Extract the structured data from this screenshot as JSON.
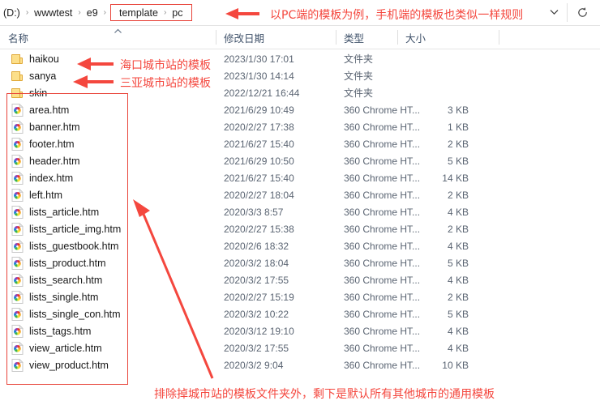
{
  "address_bar": {
    "crumbs": [
      {
        "label": "(D:)",
        "highlight": false
      },
      {
        "label": "wwwtest",
        "highlight": false
      },
      {
        "label": "e9",
        "highlight": false
      }
    ],
    "highlighted_crumbs": [
      {
        "label": "template"
      },
      {
        "label": "pc"
      }
    ],
    "separator": "›",
    "dropdown_icon": "chevron-down-icon",
    "refresh_icon": "refresh-icon",
    "refresh_glyph": "↻",
    "chevron_glyph": "⌄"
  },
  "columns": {
    "name": "名称",
    "date": "修改日期",
    "type": "类型",
    "size": "大小",
    "sort_caret": "⌃"
  },
  "rows": [
    {
      "name": "haikou",
      "icon": "folder-icon",
      "date": "2023/1/30 17:01",
      "type": "文件夹",
      "size": ""
    },
    {
      "name": "sanya",
      "icon": "folder-icon",
      "date": "2023/1/30 14:14",
      "type": "文件夹",
      "size": ""
    },
    {
      "name": "skin",
      "icon": "folder-icon",
      "date": "2022/12/21 16:44",
      "type": "文件夹",
      "size": ""
    },
    {
      "name": "area.htm",
      "icon": "html-file-icon",
      "date": "2021/6/29 10:49",
      "type": "360 Chrome HT...",
      "size": "3 KB"
    },
    {
      "name": "banner.htm",
      "icon": "html-file-icon",
      "date": "2020/2/27 17:38",
      "type": "360 Chrome HT...",
      "size": "1 KB"
    },
    {
      "name": "footer.htm",
      "icon": "html-file-icon",
      "date": "2021/6/27 15:40",
      "type": "360 Chrome HT...",
      "size": "2 KB"
    },
    {
      "name": "header.htm",
      "icon": "html-file-icon",
      "date": "2021/6/29 10:50",
      "type": "360 Chrome HT...",
      "size": "5 KB"
    },
    {
      "name": "index.htm",
      "icon": "html-file-icon",
      "date": "2021/6/27 15:40",
      "type": "360 Chrome HT...",
      "size": "14 KB"
    },
    {
      "name": "left.htm",
      "icon": "html-file-icon",
      "date": "2020/2/27 18:04",
      "type": "360 Chrome HT...",
      "size": "2 KB"
    },
    {
      "name": "lists_article.htm",
      "icon": "html-file-icon",
      "date": "2020/3/3 8:57",
      "type": "360 Chrome HT...",
      "size": "4 KB"
    },
    {
      "name": "lists_article_img.htm",
      "icon": "html-file-icon",
      "date": "2020/2/27 15:38",
      "type": "360 Chrome HT...",
      "size": "2 KB"
    },
    {
      "name": "lists_guestbook.htm",
      "icon": "html-file-icon",
      "date": "2020/2/6 18:32",
      "type": "360 Chrome HT...",
      "size": "4 KB"
    },
    {
      "name": "lists_product.htm",
      "icon": "html-file-icon",
      "date": "2020/3/2 18:04",
      "type": "360 Chrome HT...",
      "size": "5 KB"
    },
    {
      "name": "lists_search.htm",
      "icon": "html-file-icon",
      "date": "2020/3/2 17:55",
      "type": "360 Chrome HT...",
      "size": "4 KB"
    },
    {
      "name": "lists_single.htm",
      "icon": "html-file-icon",
      "date": "2020/2/27 15:19",
      "type": "360 Chrome HT...",
      "size": "2 KB"
    },
    {
      "name": "lists_single_con.htm",
      "icon": "html-file-icon",
      "date": "2020/3/2 10:22",
      "type": "360 Chrome HT...",
      "size": "5 KB"
    },
    {
      "name": "lists_tags.htm",
      "icon": "html-file-icon",
      "date": "2020/3/12 19:10",
      "type": "360 Chrome HT...",
      "size": "4 KB"
    },
    {
      "name": "view_article.htm",
      "icon": "html-file-icon",
      "date": "2020/3/2 17:55",
      "type": "360 Chrome HT...",
      "size": "4 KB"
    },
    {
      "name": "view_product.htm",
      "icon": "html-file-icon",
      "date": "2020/3/2 9:04",
      "type": "360 Chrome HT...",
      "size": "10 KB"
    }
  ],
  "annotations": {
    "color": "#f4473e",
    "address_note": "以PC端的模板为例，手机端的模板也类似一样规则",
    "haikou_note": "海口城市站的模板",
    "sanya_note": "三亚城市站的模板",
    "bottom_note": "排除掉城市站的模板文件夹外，剩下是默认所有其他城市的通用模板"
  }
}
